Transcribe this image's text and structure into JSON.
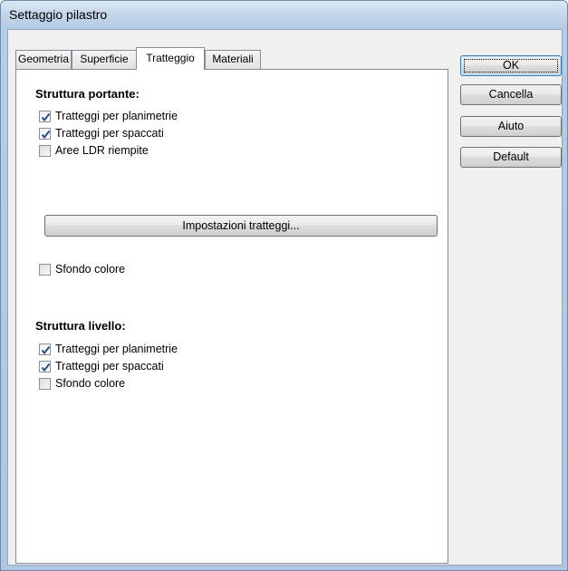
{
  "window": {
    "title": "Settaggio pilastro"
  },
  "tabs": [
    {
      "label": "Geometria",
      "active": false
    },
    {
      "label": "Superficie",
      "active": false
    },
    {
      "label": "Tratteggio",
      "active": true
    },
    {
      "label": "Materiali",
      "active": false
    }
  ],
  "structure_bearing": {
    "title": "Struttura portante:",
    "options": [
      {
        "label": "Tratteggi per planimetrie",
        "checked": true
      },
      {
        "label": "Tratteggi per spaccati",
        "checked": true
      },
      {
        "label": "Aree LDR riempite",
        "checked": false
      }
    ],
    "hatch_settings_button": "Impostazioni tratteggi...",
    "color_background": {
      "label": "Sfondo colore",
      "checked": false
    }
  },
  "structure_level": {
    "title": "Struttura livello:",
    "options": [
      {
        "label": "Tratteggi per planimetrie",
        "checked": true
      },
      {
        "label": "Tratteggi per spaccati",
        "checked": true
      },
      {
        "label": "Sfondo colore",
        "checked": false
      }
    ]
  },
  "buttons": {
    "ok": "OK",
    "cancel": "Cancella",
    "help": "Aiuto",
    "default": "Default"
  },
  "icons": {
    "check": "checkmark-icon"
  },
  "colors": {
    "check_mark": "#2a4f86",
    "title_bar": "#c3d6ea",
    "panel": "#f0f0f0"
  }
}
